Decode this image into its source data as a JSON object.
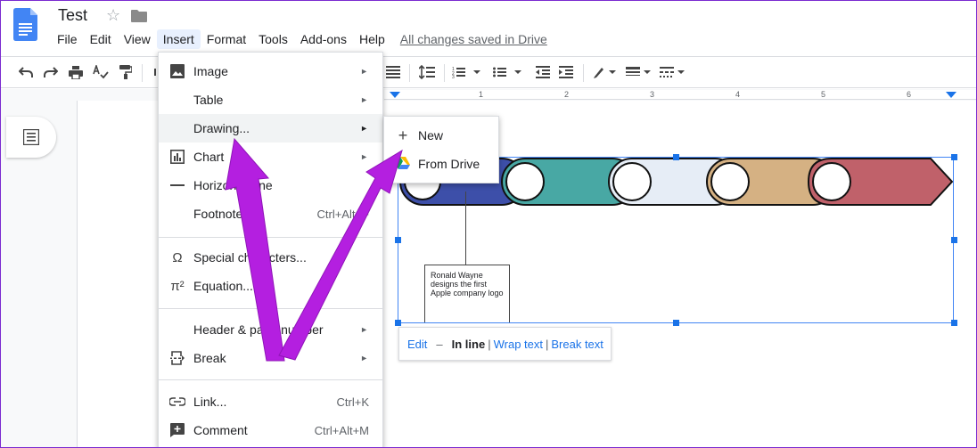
{
  "header": {
    "doc_title": "Test",
    "menus": [
      "File",
      "Edit",
      "View",
      "Insert",
      "Format",
      "Tools",
      "Add-ons",
      "Help"
    ],
    "active_menu": "Insert",
    "save_status": "All changes saved in Drive"
  },
  "ruler": {
    "numbers": [
      "1",
      "2",
      "3",
      "4",
      "5",
      "6"
    ]
  },
  "insert_menu": {
    "image": "Image",
    "table": "Table",
    "drawing": "Drawing...",
    "chart": "Chart",
    "horizontal_line": "Horizontal line",
    "footnote": "Footnote",
    "footnote_shortcut": "Ctrl+Alt+F",
    "special_characters": "Special characters...",
    "equation": "Equation...",
    "header_page_number": "Header & page number",
    "break": "Break",
    "link": "Link...",
    "link_shortcut": "Ctrl+K",
    "comment": "Comment",
    "comment_shortcut": "Ctrl+Alt+M"
  },
  "drawing_submenu": {
    "new": "New",
    "from_drive": "From Drive"
  },
  "drawing": {
    "annotation": "Ronald Wayne designs the first Apple company logo"
  },
  "inline_toolbar": {
    "edit": "Edit",
    "dash": "–",
    "in_line": "In line",
    "wrap_text": "Wrap text",
    "break_text": "Break text"
  },
  "colors": {
    "accent": "#1a73e8",
    "annotation_arrow": "#b41fe0",
    "segments": [
      "#3d4fa9",
      "#48a8a4",
      "#e6edf6",
      "#d5b183",
      "#c0616a"
    ]
  }
}
